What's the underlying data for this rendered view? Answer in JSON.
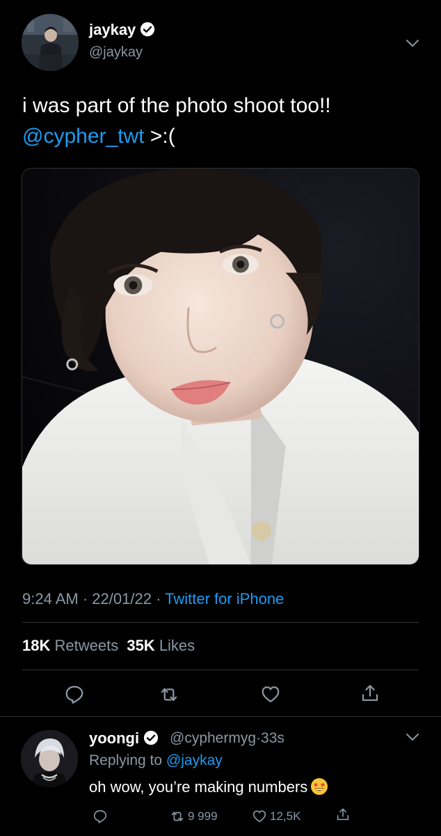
{
  "tweet": {
    "author_name": "jaykay",
    "author_handle": "@jaykay",
    "text_line1": "i was part of the photo shoot too!!",
    "mention": "@cypher_twt",
    "text_after_mention": " >:(",
    "time": "9:24 AM",
    "date": "22/01/22",
    "separator": "·",
    "source": "Twitter for iPhone",
    "retweets_count": "18K",
    "retweets_label": "Retweets",
    "likes_count": "35K",
    "likes_label": "Likes"
  },
  "reply": {
    "author_name": "yoongi",
    "author_handle": "@cyphermyg",
    "separator": "·",
    "age": "33s",
    "replying_prefix": "Replying to",
    "replying_handle": "@jaykay",
    "text": "oh wow, you’re making numbers",
    "retweet_count": "9 999",
    "like_count": "12,5K"
  },
  "icons": {
    "verified": "verified-badge-icon",
    "chevron": "chevron-down-icon",
    "reply": "reply-icon",
    "retweet": "retweet-icon",
    "like": "heart-icon",
    "share": "share-icon",
    "emoji": "star-struck-emoji-icon"
  },
  "colors": {
    "background": "#000000",
    "link": "#1d9bf0",
    "muted": "#8b98a5",
    "divider": "#2f3336"
  }
}
